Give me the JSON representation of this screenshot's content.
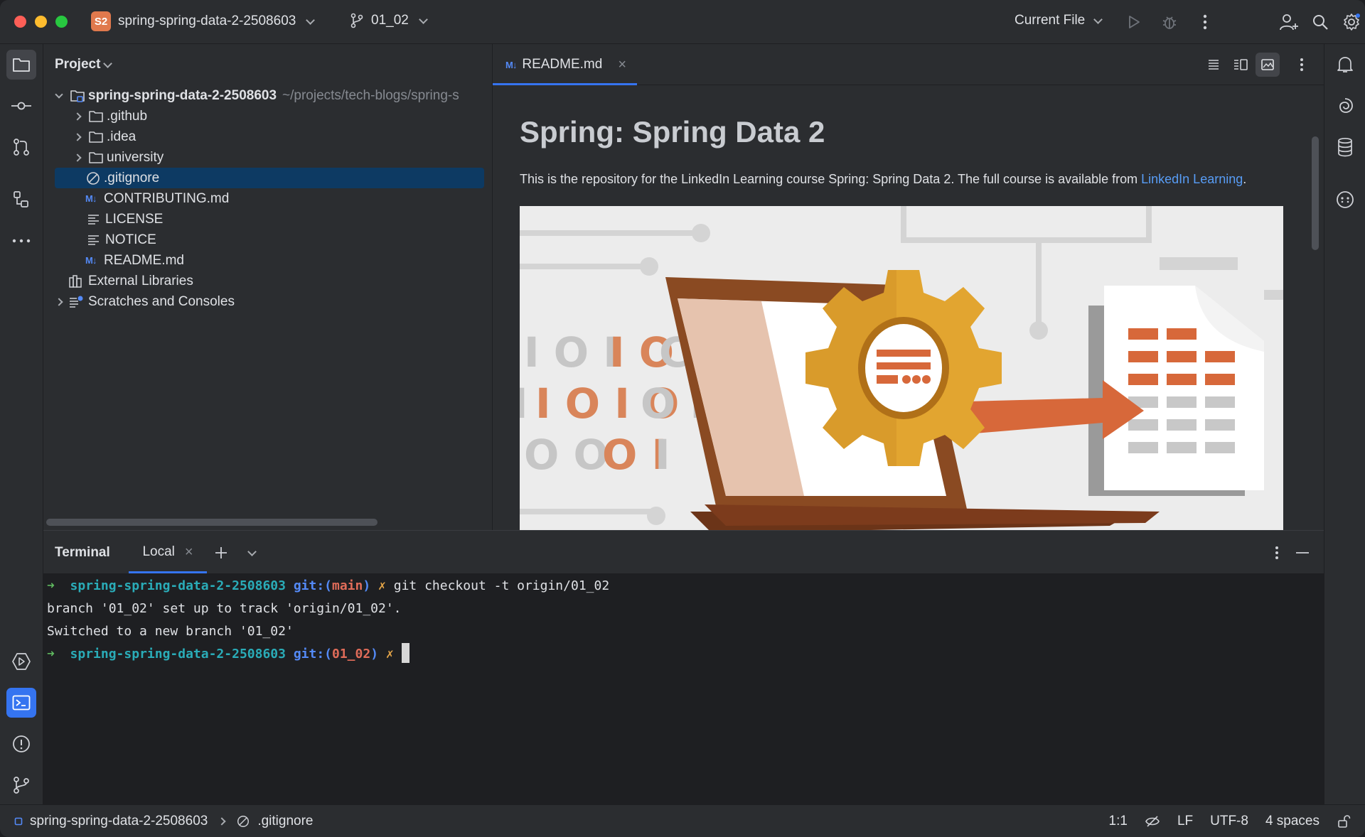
{
  "titlebar": {
    "project_badge": "S2",
    "project_name": "spring-spring-data-2-2508603",
    "branch": "01_02",
    "run_config": "Current File"
  },
  "project_panel": {
    "title": "Project",
    "root": {
      "name": "spring-spring-data-2-2508603",
      "path_hint": "~/projects/tech-blogs/spring-s"
    },
    "items": [
      {
        "label": ".github",
        "type": "folder"
      },
      {
        "label": ".idea",
        "type": "folder"
      },
      {
        "label": "university",
        "type": "folder"
      },
      {
        "label": ".gitignore",
        "type": "ignore",
        "selected": true
      },
      {
        "label": "CONTRIBUTING.md",
        "type": "markdown"
      },
      {
        "label": "LICENSE",
        "type": "text"
      },
      {
        "label": "NOTICE",
        "type": "text"
      },
      {
        "label": "README.md",
        "type": "markdown"
      }
    ],
    "external_libraries": "External Libraries",
    "scratches": "Scratches and Consoles"
  },
  "editor": {
    "tab": {
      "badge": "M↓",
      "label": "README.md"
    },
    "preview": {
      "heading": "Spring: Spring Data 2",
      "paragraph_prefix": "This is the repository for the LinkedIn Learning course Spring: Spring Data 2. The full course is available from ",
      "link_text": "LinkedIn Learning",
      "paragraph_suffix": "."
    }
  },
  "terminal": {
    "title": "Terminal",
    "tab_label": "Local",
    "lines": [
      {
        "prompt": "➜",
        "dir": "spring-spring-data-2-2508603",
        "git_prefix": "git:(",
        "branch": "main",
        "git_suffix": ")",
        "dirty": "✗",
        "command": "git checkout -t origin/01_02"
      },
      {
        "output": "branch '01_02' set up to track 'origin/01_02'."
      },
      {
        "output": "Switched to a new branch '01_02'"
      },
      {
        "prompt": "➜",
        "dir": "spring-spring-data-2-2508603",
        "git_prefix": "git:(",
        "branch": "01_02",
        "git_suffix": ")",
        "dirty": "✗"
      }
    ]
  },
  "statusbar": {
    "project": "spring-spring-data-2-2508603",
    "file": ".gitignore",
    "position": "1:1",
    "line_ending": "LF",
    "encoding": "UTF-8",
    "indent": "4 spaces"
  },
  "colors": {
    "accent": "#3574f0",
    "selection": "#0d3a63",
    "badge": "#e0794d",
    "link": "#589df6"
  }
}
